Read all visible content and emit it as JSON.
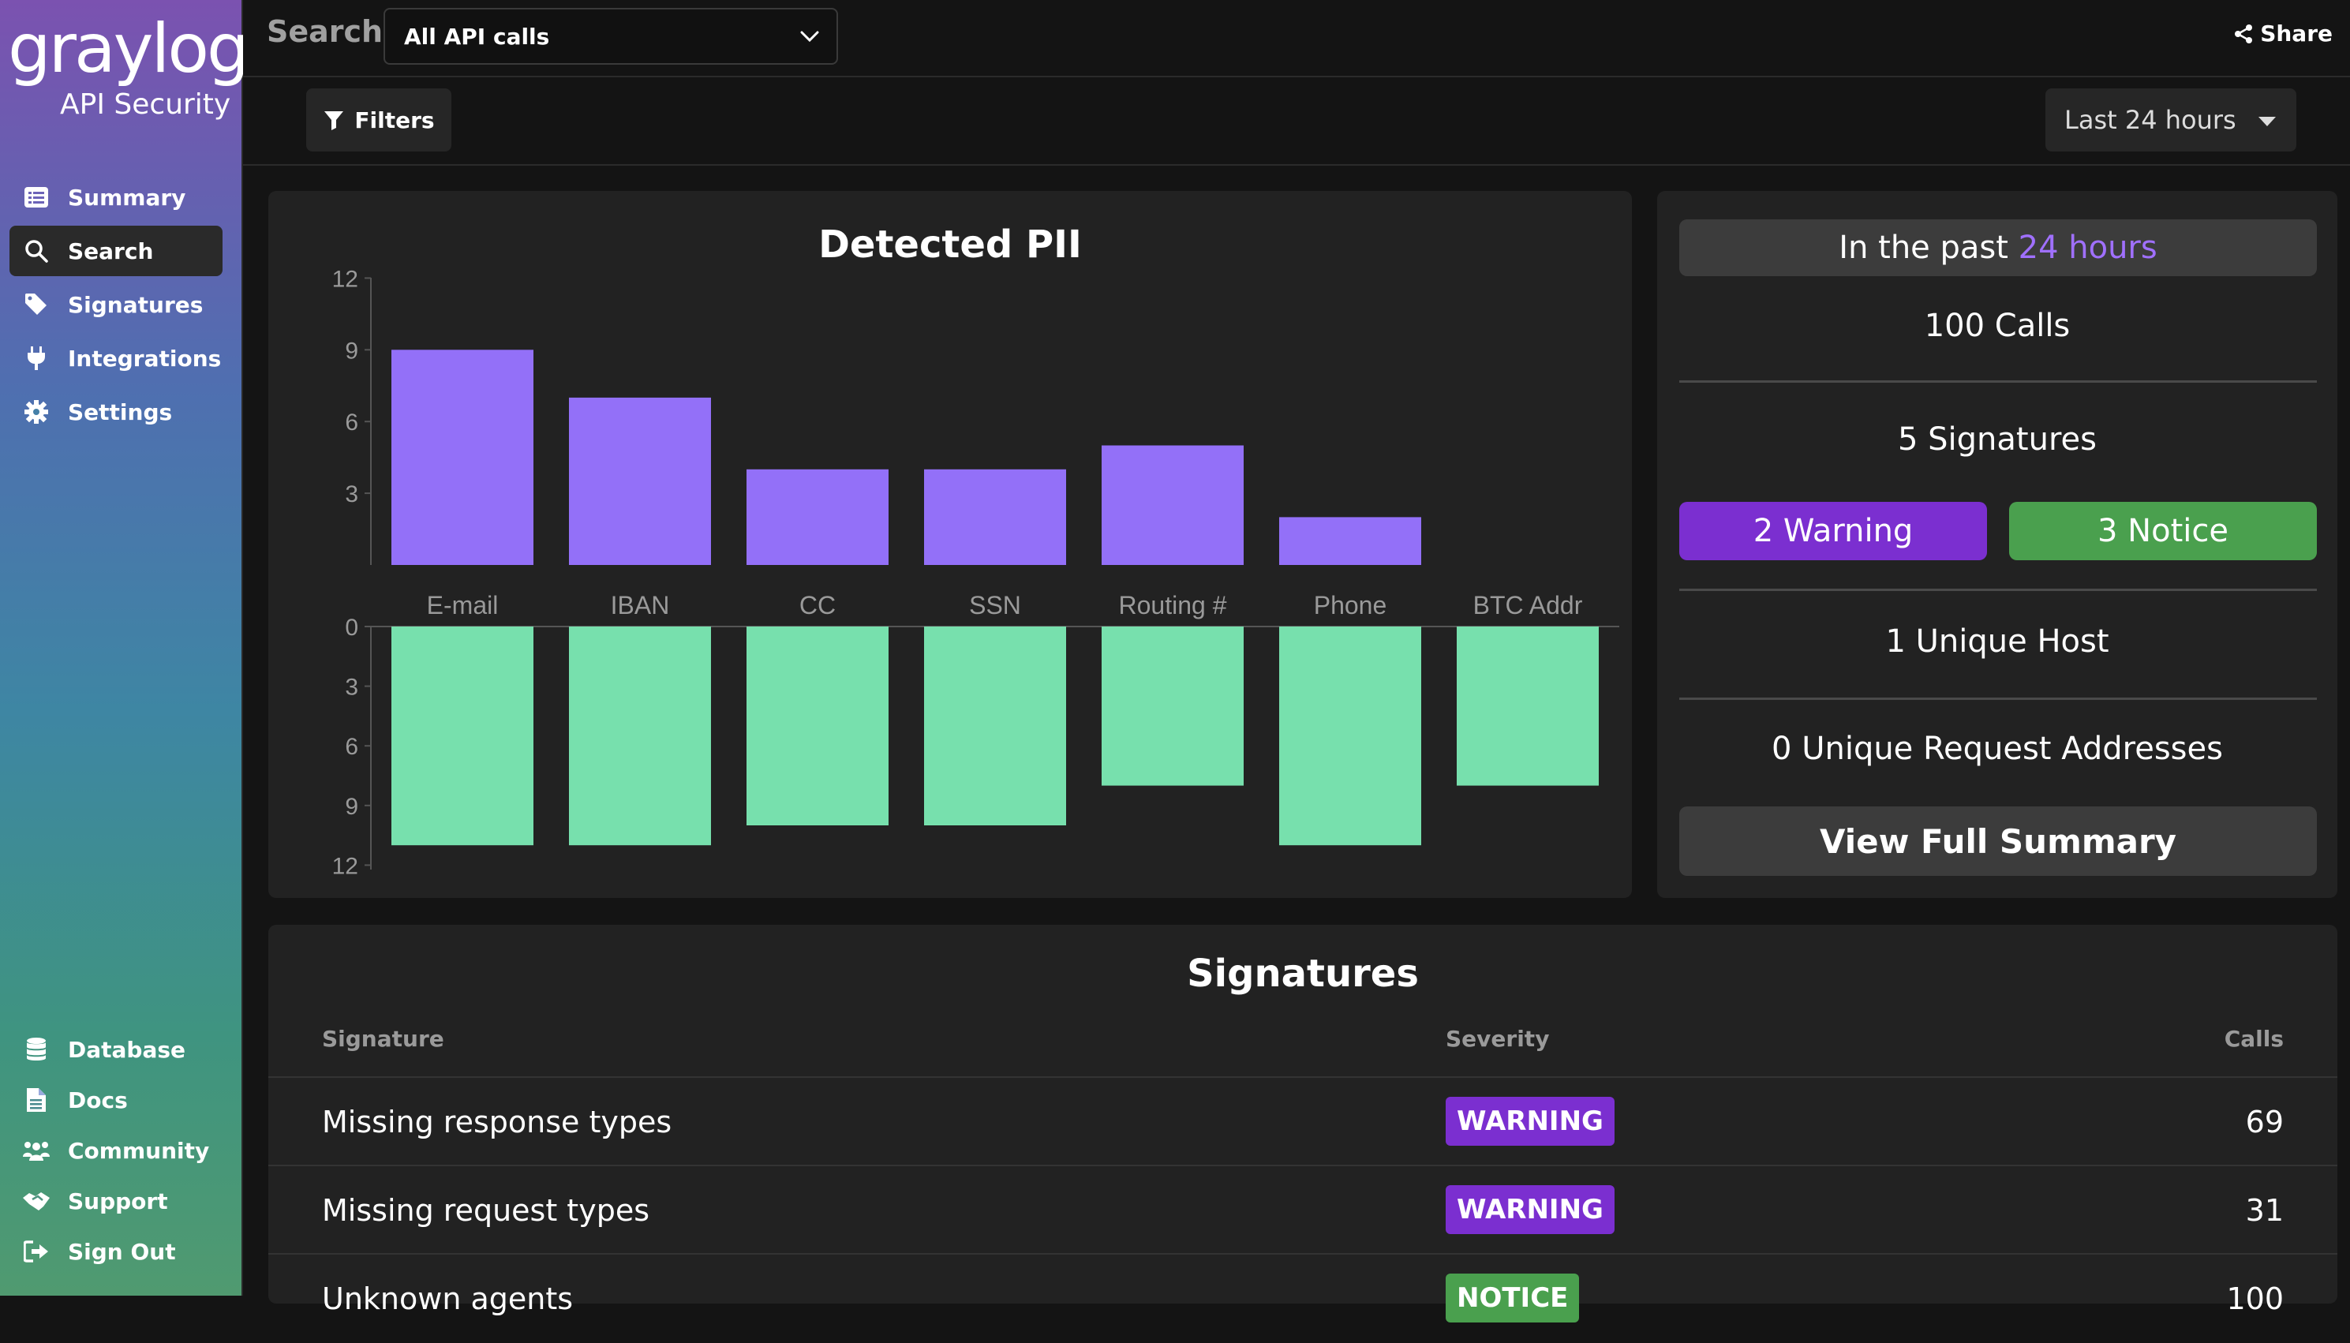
{
  "sidebar": {
    "logo_word": "graylog",
    "logo_sub": "API Security",
    "nav_top": [
      {
        "label": "Summary",
        "icon": "list-icon"
      },
      {
        "label": "Search",
        "icon": "search-icon",
        "active": true
      },
      {
        "label": "Signatures",
        "icon": "tag-icon"
      },
      {
        "label": "Integrations",
        "icon": "plug-icon"
      },
      {
        "label": "Settings",
        "icon": "gear-icon"
      }
    ],
    "nav_bottom": [
      {
        "label": "Database",
        "icon": "database-icon"
      },
      {
        "label": "Docs",
        "icon": "document-icon"
      },
      {
        "label": "Community",
        "icon": "people-icon"
      },
      {
        "label": "Support",
        "icon": "handshake-icon"
      },
      {
        "label": "Sign Out",
        "icon": "sign-out-icon"
      }
    ]
  },
  "topbar": {
    "search_label": "Search",
    "search_select": "All API calls",
    "share_label": "Share"
  },
  "filterbar": {
    "filters_label": "Filters",
    "time_range": "Last 24 hours"
  },
  "chart_data": {
    "type": "bar",
    "title": "Detected PII",
    "categories": [
      "E-mail",
      "IBAN",
      "CC",
      "SSN",
      "Routing #",
      "Phone",
      "BTC Addr"
    ],
    "series": [
      {
        "values": [
          9,
          7,
          4,
          4,
          5,
          2,
          0
        ],
        "color": "#9370f8"
      },
      {
        "values": [
          11,
          11,
          10,
          10,
          8,
          11,
          8
        ],
        "color": "#77e0ad"
      }
    ],
    "top_ylim": [
      0,
      12
    ],
    "bottom_ylim": [
      0,
      12
    ],
    "top_ticks": [
      "12",
      "9",
      "6",
      "3"
    ],
    "bottom_ticks": [
      "0",
      "3",
      "6",
      "9",
      "12"
    ]
  },
  "stats": {
    "past_prefix": "In the past ",
    "past_highlight": "24 hours",
    "calls": "100 Calls",
    "signatures": "5 Signatures",
    "warning": "2 Warning",
    "notice": "3 Notice",
    "hosts": "1 Unique Host",
    "addresses": "0 Unique Request Addresses",
    "summary_button": "View Full Summary",
    "accent": "#a070ff"
  },
  "signatures": {
    "title": "Signatures",
    "col_signature": "Signature",
    "col_severity": "Severity",
    "col_calls": "Calls",
    "rows": [
      {
        "name": "Missing response types",
        "severity": "WARNING",
        "calls": "69",
        "color": "#7b2fd0"
      },
      {
        "name": "Missing request types",
        "severity": "WARNING",
        "calls": "31",
        "color": "#7b2fd0"
      },
      {
        "name": "Unknown agents",
        "severity": "NOTICE",
        "calls": "100",
        "color": "#4aa04e"
      }
    ]
  }
}
